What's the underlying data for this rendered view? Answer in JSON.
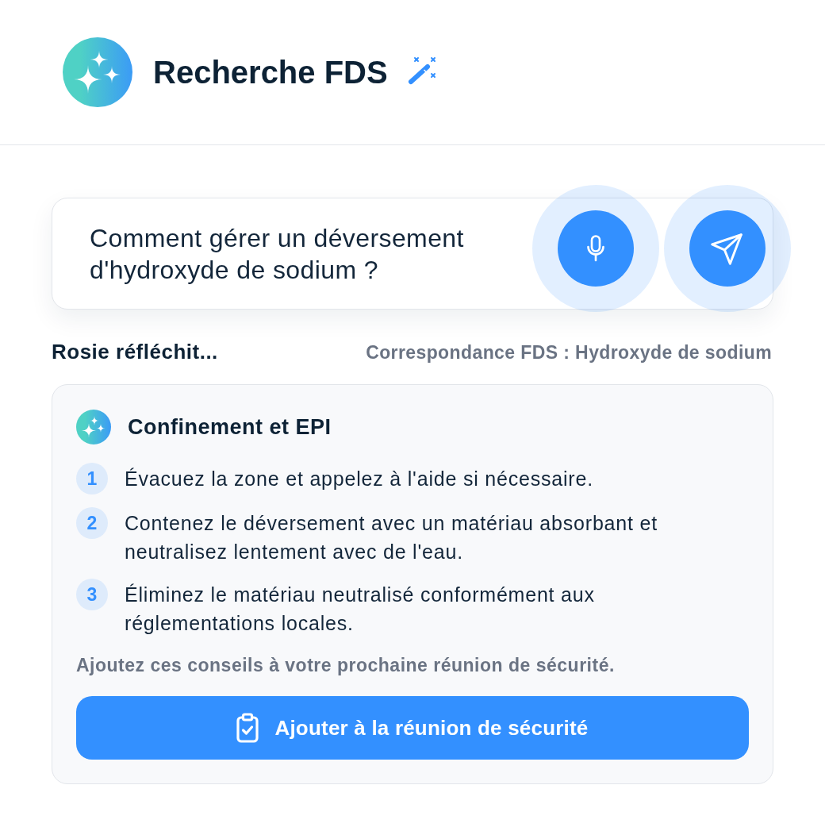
{
  "header": {
    "title": "Recherche FDS"
  },
  "query": {
    "value": "Comment gérer un déversement d'hydroxyde de sodium ?"
  },
  "status": {
    "thinking": "Rosie réfléchit...",
    "match": "Correspondance FDS : Hydroxyde de sodium"
  },
  "card": {
    "title": "Confinement et EPI",
    "steps": [
      {
        "number": "1",
        "text": "Évacuez la zone et appelez à l'aide si nécessaire."
      },
      {
        "number": "2",
        "text": "Contenez le déversement avec un matériau absorbant et neutralisez lentement avec de l'eau."
      },
      {
        "number": "3",
        "text": "Éliminez le matériau neutralisé conformément aux réglementations locales."
      }
    ],
    "note": "Ajoutez ces conseils à votre prochaine réunion de sécurité.",
    "button": {
      "label": "Ajouter à la réunion de sécurité"
    }
  }
}
